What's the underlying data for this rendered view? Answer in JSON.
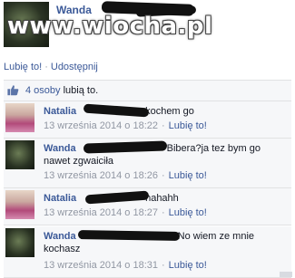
{
  "post": {
    "author": "Wanda",
    "watermark": "www.wiocha.pl",
    "actions": {
      "like": "Lubię to!",
      "separator": "·",
      "share": "Udostępnij"
    }
  },
  "likes": {
    "count_text": "4 osoby",
    "suffix": "lubią to."
  },
  "comments": [
    {
      "author": "Natalia",
      "text": "kochem go",
      "timestamp": "13 września 2014 o 18:22",
      "like_label": "Lubię to!"
    },
    {
      "author": "Wanda",
      "text": "Bibera?ja tez bym go nawet zgwaiciła",
      "timestamp": "13 września 2014 o 18:26",
      "like_label": "Lubię to!"
    },
    {
      "author": "Natalia",
      "text": "hahahh",
      "timestamp": "13 września 2014 o 18:27",
      "like_label": "Lubię to!"
    },
    {
      "author": "Wanda",
      "text": "No wiem ze mnie kochasz",
      "timestamp": "13 września 2014 o 18:31",
      "like_label": "Lubię to!"
    }
  ],
  "icons": {
    "like": "thumbs-up-icon"
  },
  "colors": {
    "link": "#3b5998",
    "meta": "#9197a3",
    "comment_bg": "#f6f7f9"
  }
}
